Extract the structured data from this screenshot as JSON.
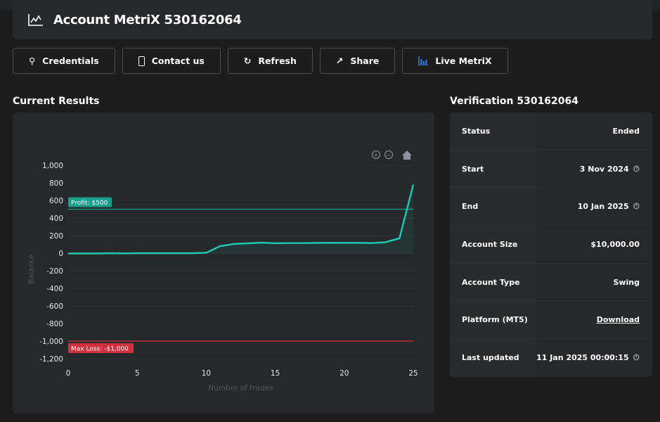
{
  "header": {
    "title": "Account MetriX 530162064",
    "icon": "line-chart-icon"
  },
  "buttons": [
    {
      "label": "Credentials",
      "icon": "key-icon"
    },
    {
      "label": "Contact us",
      "icon": "phone-icon"
    },
    {
      "label": "Refresh",
      "icon": "refresh-icon"
    },
    {
      "label": "Share",
      "icon": "share-icon"
    },
    {
      "label": "Live MetriX",
      "icon": "bar-chart-icon",
      "icon_color": "#2f80ed"
    }
  ],
  "results": {
    "title": "Current Results"
  },
  "verification": {
    "title": "Verification 530162064",
    "rows": [
      {
        "label": "Status",
        "value": "Ended"
      },
      {
        "label": "Start",
        "value": "3 Nov 2024",
        "icon": "timer-icon"
      },
      {
        "label": "End",
        "value": "10 Jan 2025",
        "icon": "timer-icon"
      },
      {
        "label": "Account Size",
        "value": "$10,000.00"
      },
      {
        "label": "Account Type",
        "value": "Swing"
      },
      {
        "label": "Platform (MT5)",
        "value": "Download",
        "link": true
      },
      {
        "label": "Last updated",
        "value": "11 Jan 2025 00:00:15",
        "icon": "timer-icon"
      }
    ]
  },
  "chart_data": {
    "type": "area",
    "xlabel": "Number of trades",
    "ylabel": "Balance",
    "xlim": [
      0,
      25
    ],
    "ylim": [
      -1200,
      1000
    ],
    "xticks": [
      "0",
      "5",
      "10",
      "15",
      "20",
      "25"
    ],
    "yticks": [
      "1,000",
      "800",
      "600",
      "400",
      "200",
      "0",
      "-200",
      "-400",
      "-600",
      "-800",
      "-1,000",
      "-1,200"
    ],
    "grid": true,
    "line_color": "#1fc7b0",
    "x": [
      0,
      1,
      2,
      3,
      4,
      5,
      6,
      7,
      8,
      9,
      10,
      11,
      12,
      13,
      14,
      15,
      16,
      17,
      18,
      19,
      20,
      21,
      22,
      23,
      24,
      25
    ],
    "values": [
      -3,
      -3,
      -3,
      0,
      -2,
      0,
      0,
      0,
      0,
      0,
      5,
      80,
      105,
      112,
      120,
      113,
      115,
      115,
      117,
      118,
      118,
      118,
      115,
      125,
      170,
      780
    ],
    "annotations": [
      {
        "label": "Profit: $500",
        "y": 500,
        "color": "#1a9e8c"
      },
      {
        "label": "Max Loss: -$1,000",
        "y": -1000,
        "color": "#d1303f"
      }
    ],
    "toolbar": [
      "zoom-in-icon",
      "zoom-out-icon",
      "home-icon"
    ]
  }
}
